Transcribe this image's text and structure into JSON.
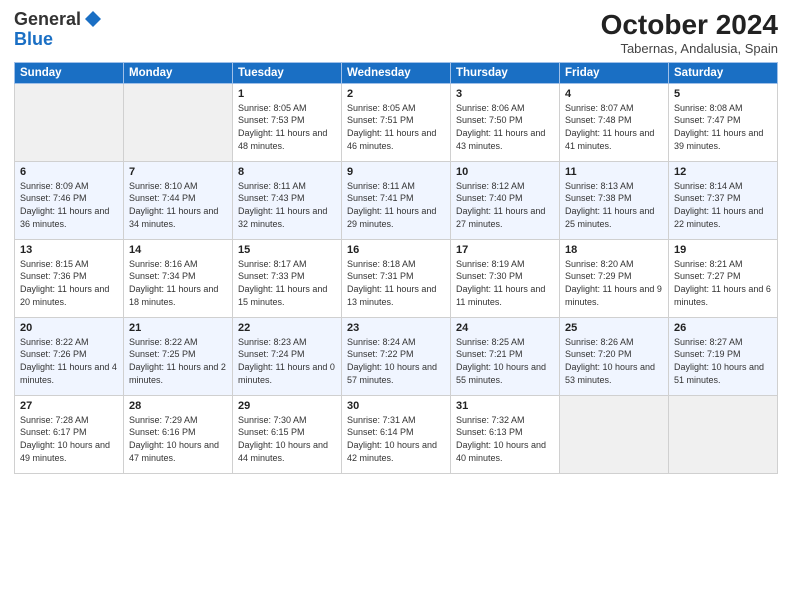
{
  "logo": {
    "text_general": "General",
    "text_blue": "Blue"
  },
  "header": {
    "month": "October 2024",
    "location": "Tabernas, Andalusia, Spain"
  },
  "days_of_week": [
    "Sunday",
    "Monday",
    "Tuesday",
    "Wednesday",
    "Thursday",
    "Friday",
    "Saturday"
  ],
  "weeks": [
    [
      {
        "day": "",
        "content": ""
      },
      {
        "day": "",
        "content": ""
      },
      {
        "day": "1",
        "content": "Sunrise: 8:05 AM\nSunset: 7:53 PM\nDaylight: 11 hours and 48 minutes."
      },
      {
        "day": "2",
        "content": "Sunrise: 8:05 AM\nSunset: 7:51 PM\nDaylight: 11 hours and 46 minutes."
      },
      {
        "day": "3",
        "content": "Sunrise: 8:06 AM\nSunset: 7:50 PM\nDaylight: 11 hours and 43 minutes."
      },
      {
        "day": "4",
        "content": "Sunrise: 8:07 AM\nSunset: 7:48 PM\nDaylight: 11 hours and 41 minutes."
      },
      {
        "day": "5",
        "content": "Sunrise: 8:08 AM\nSunset: 7:47 PM\nDaylight: 11 hours and 39 minutes."
      }
    ],
    [
      {
        "day": "6",
        "content": "Sunrise: 8:09 AM\nSunset: 7:46 PM\nDaylight: 11 hours and 36 minutes."
      },
      {
        "day": "7",
        "content": "Sunrise: 8:10 AM\nSunset: 7:44 PM\nDaylight: 11 hours and 34 minutes."
      },
      {
        "day": "8",
        "content": "Sunrise: 8:11 AM\nSunset: 7:43 PM\nDaylight: 11 hours and 32 minutes."
      },
      {
        "day": "9",
        "content": "Sunrise: 8:11 AM\nSunset: 7:41 PM\nDaylight: 11 hours and 29 minutes."
      },
      {
        "day": "10",
        "content": "Sunrise: 8:12 AM\nSunset: 7:40 PM\nDaylight: 11 hours and 27 minutes."
      },
      {
        "day": "11",
        "content": "Sunrise: 8:13 AM\nSunset: 7:38 PM\nDaylight: 11 hours and 25 minutes."
      },
      {
        "day": "12",
        "content": "Sunrise: 8:14 AM\nSunset: 7:37 PM\nDaylight: 11 hours and 22 minutes."
      }
    ],
    [
      {
        "day": "13",
        "content": "Sunrise: 8:15 AM\nSunset: 7:36 PM\nDaylight: 11 hours and 20 minutes."
      },
      {
        "day": "14",
        "content": "Sunrise: 8:16 AM\nSunset: 7:34 PM\nDaylight: 11 hours and 18 minutes."
      },
      {
        "day": "15",
        "content": "Sunrise: 8:17 AM\nSunset: 7:33 PM\nDaylight: 11 hours and 15 minutes."
      },
      {
        "day": "16",
        "content": "Sunrise: 8:18 AM\nSunset: 7:31 PM\nDaylight: 11 hours and 13 minutes."
      },
      {
        "day": "17",
        "content": "Sunrise: 8:19 AM\nSunset: 7:30 PM\nDaylight: 11 hours and 11 minutes."
      },
      {
        "day": "18",
        "content": "Sunrise: 8:20 AM\nSunset: 7:29 PM\nDaylight: 11 hours and 9 minutes."
      },
      {
        "day": "19",
        "content": "Sunrise: 8:21 AM\nSunset: 7:27 PM\nDaylight: 11 hours and 6 minutes."
      }
    ],
    [
      {
        "day": "20",
        "content": "Sunrise: 8:22 AM\nSunset: 7:26 PM\nDaylight: 11 hours and 4 minutes."
      },
      {
        "day": "21",
        "content": "Sunrise: 8:22 AM\nSunset: 7:25 PM\nDaylight: 11 hours and 2 minutes."
      },
      {
        "day": "22",
        "content": "Sunrise: 8:23 AM\nSunset: 7:24 PM\nDaylight: 11 hours and 0 minutes."
      },
      {
        "day": "23",
        "content": "Sunrise: 8:24 AM\nSunset: 7:22 PM\nDaylight: 10 hours and 57 minutes."
      },
      {
        "day": "24",
        "content": "Sunrise: 8:25 AM\nSunset: 7:21 PM\nDaylight: 10 hours and 55 minutes."
      },
      {
        "day": "25",
        "content": "Sunrise: 8:26 AM\nSunset: 7:20 PM\nDaylight: 10 hours and 53 minutes."
      },
      {
        "day": "26",
        "content": "Sunrise: 8:27 AM\nSunset: 7:19 PM\nDaylight: 10 hours and 51 minutes."
      }
    ],
    [
      {
        "day": "27",
        "content": "Sunrise: 7:28 AM\nSunset: 6:17 PM\nDaylight: 10 hours and 49 minutes."
      },
      {
        "day": "28",
        "content": "Sunrise: 7:29 AM\nSunset: 6:16 PM\nDaylight: 10 hours and 47 minutes."
      },
      {
        "day": "29",
        "content": "Sunrise: 7:30 AM\nSunset: 6:15 PM\nDaylight: 10 hours and 44 minutes."
      },
      {
        "day": "30",
        "content": "Sunrise: 7:31 AM\nSunset: 6:14 PM\nDaylight: 10 hours and 42 minutes."
      },
      {
        "day": "31",
        "content": "Sunrise: 7:32 AM\nSunset: 6:13 PM\nDaylight: 10 hours and 40 minutes."
      },
      {
        "day": "",
        "content": ""
      },
      {
        "day": "",
        "content": ""
      }
    ]
  ]
}
